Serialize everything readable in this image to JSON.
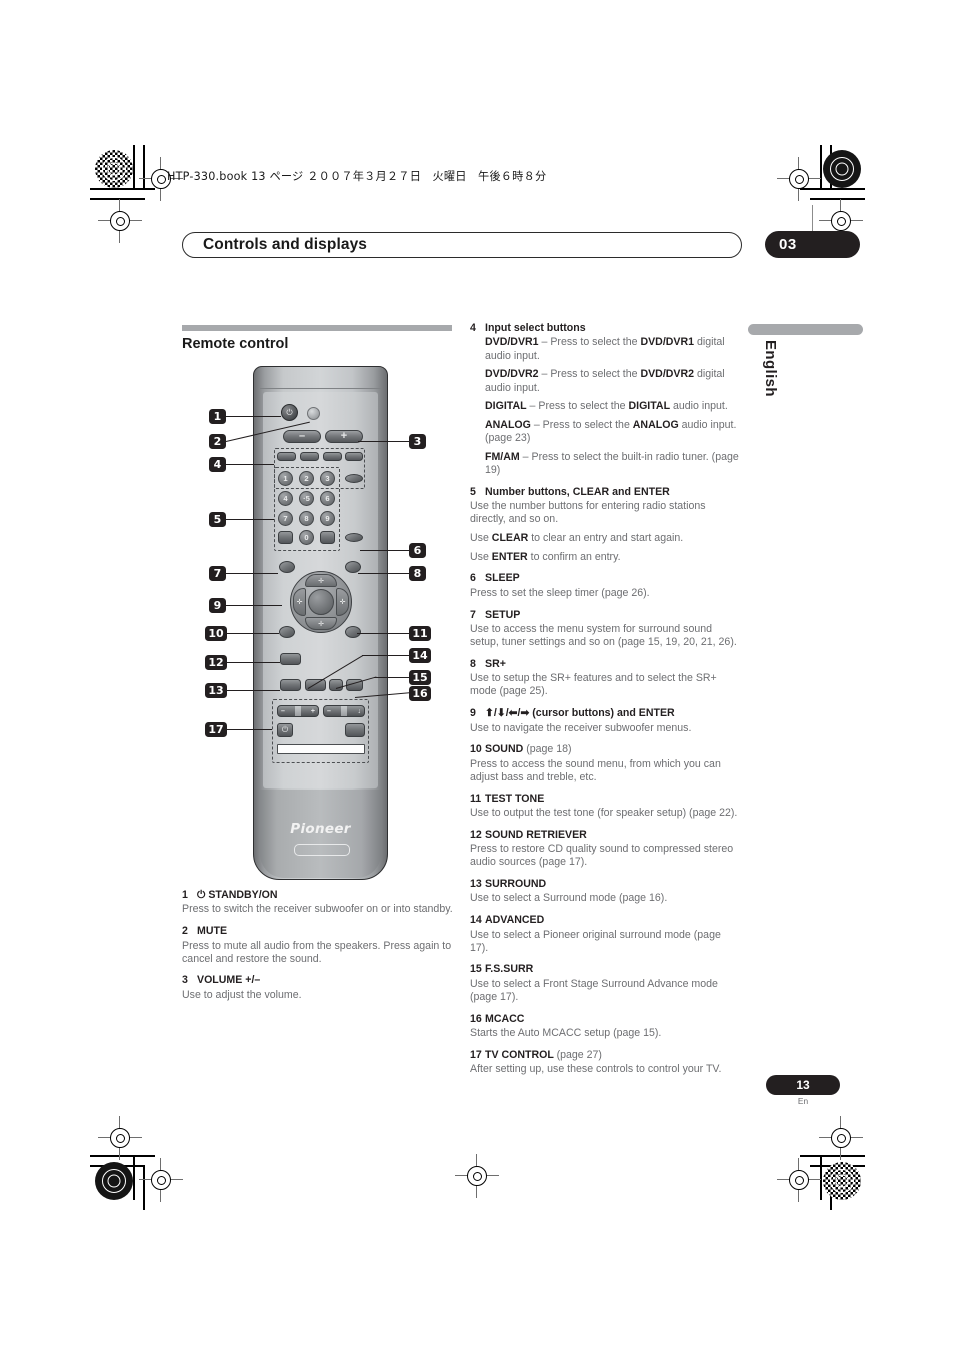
{
  "print": {
    "file_banner": "HTP-330.book  13 ページ  ２００７年３月２７日　火曜日　午後６時８分"
  },
  "header": {
    "chapter_title": "Controls and displays",
    "chapter_number": "03",
    "language_tab": "English"
  },
  "section": {
    "title": "Remote control"
  },
  "remote": {
    "brand": "Pioneer",
    "number_keys": [
      "1",
      "2",
      "3",
      "4",
      "·5",
      "6",
      "7",
      "8",
      "9",
      "0"
    ],
    "volume_minus": "–",
    "volume_plus": "+",
    "cursor_up": "✛",
    "cursor_down": "✛",
    "cursor_left": "✛",
    "cursor_right": "✛",
    "power_glyph": "⏻",
    "tv_power_glyph": "⏻",
    "tv_rocker_left": [
      "–",
      "+"
    ],
    "tv_rocker_right": [
      "–",
      "↓"
    ],
    "callouts": [
      "1",
      "2",
      "3",
      "4",
      "5",
      "6",
      "7",
      "8",
      "9",
      "10",
      "11",
      "12",
      "13",
      "14",
      "15",
      "16",
      "17"
    ]
  },
  "left_column": [
    {
      "num": "1",
      "title": "⏻ STANDBY/ON",
      "lines": [
        {
          "text": "Press to switch the receiver subwoofer on or into standby."
        }
      ]
    },
    {
      "num": "2",
      "title": "MUTE",
      "lines": [
        {
          "text": "Press to mute all audio from the speakers. Press again to cancel and restore the sound."
        }
      ]
    },
    {
      "num": "3",
      "title": "VOLUME +/–",
      "lines": [
        {
          "text": "Use to adjust the volume."
        }
      ]
    }
  ],
  "right_column": [
    {
      "num": "4",
      "title": "Input select buttons",
      "lines": [
        {
          "html": "<b>DVD/DVR1</b> – Press to select the <b>DVD/DVR1</b> digital audio input.",
          "indent": true
        },
        {
          "html": "<b>DVD/DVR2</b> – Press to select the <b>DVD/DVR2</b> digital audio input.",
          "indent": true
        },
        {
          "html": "<b>DIGITAL</b> – Press to select the <b>DIGITAL</b> audio input.",
          "indent": true
        },
        {
          "html": "<b>ANALOG</b> – Press to select the <b>ANALOG</b> audio input. (page 23)",
          "indent": true
        },
        {
          "html": "<b>FM/AM</b> – Press to select the built-in radio tuner. (page 19)",
          "indent": true
        }
      ]
    },
    {
      "num": "5",
      "title": "Number buttons, CLEAR and ENTER",
      "lines": [
        {
          "html": "Use the number buttons for entering radio stations directly, and so on."
        },
        {
          "html": "Use <b>CLEAR</b> to clear an entry and start again."
        },
        {
          "html": "Use <b>ENTER</b> to confirm an entry."
        }
      ]
    },
    {
      "num": "6",
      "title": "SLEEP",
      "lines": [
        {
          "html": "Press to set the sleep timer (page 26)."
        }
      ]
    },
    {
      "num": "7",
      "title": "SETUP",
      "lines": [
        {
          "html": "Use to access the menu system for surround sound setup, tuner settings and so on (page 15, 19, 20, 21, 26)."
        }
      ]
    },
    {
      "num": "8",
      "title": "SR+",
      "lines": [
        {
          "html": "Use to setup the SR+ features and to select the SR+ mode (page 25)."
        }
      ]
    },
    {
      "num": "9",
      "title": "⬆/⬇/⬅/➡ (cursor buttons) and ENTER",
      "lines": [
        {
          "html": "Use to navigate the receiver subwoofer menus."
        }
      ]
    },
    {
      "num": "10",
      "title": "SOUND",
      "page_ref": "(page 18)",
      "lines": [
        {
          "html": "Press to access the sound menu, from which you can adjust bass and treble, etc."
        }
      ]
    },
    {
      "num": "11",
      "title": "TEST TONE",
      "lines": [
        {
          "html": "Use to output the test tone (for speaker setup) (page 22)."
        }
      ]
    },
    {
      "num": "12",
      "title": "SOUND RETRIEVER",
      "lines": [
        {
          "html": "Press to restore CD quality sound to compressed stereo audio sources (page 17)."
        }
      ]
    },
    {
      "num": "13",
      "title": "SURROUND",
      "lines": [
        {
          "html": "Use to select a Surround mode (page 16)."
        }
      ]
    },
    {
      "num": "14",
      "title": "ADVANCED",
      "lines": [
        {
          "html": "Use to select a Pioneer original surround mode (page 17)."
        }
      ]
    },
    {
      "num": "15",
      "title": "F.S.SURR",
      "lines": [
        {
          "html": "Use to select a Front Stage Surround Advance mode (page 17)."
        }
      ]
    },
    {
      "num": "16",
      "title": "MCACC",
      "lines": [
        {
          "html": "Starts the Auto MCACC setup (page 15)."
        }
      ]
    },
    {
      "num": "17",
      "title": "TV CONTROL",
      "page_ref": "(page 27)",
      "lines": [
        {
          "html": "After setting up, use these controls to control your TV."
        }
      ]
    }
  ],
  "footer": {
    "page_number": "13",
    "language_code": "En"
  },
  "colors": {
    "ink": "#231f20",
    "body_text": "#6d6e71",
    "rule": "#a7a9ac"
  }
}
